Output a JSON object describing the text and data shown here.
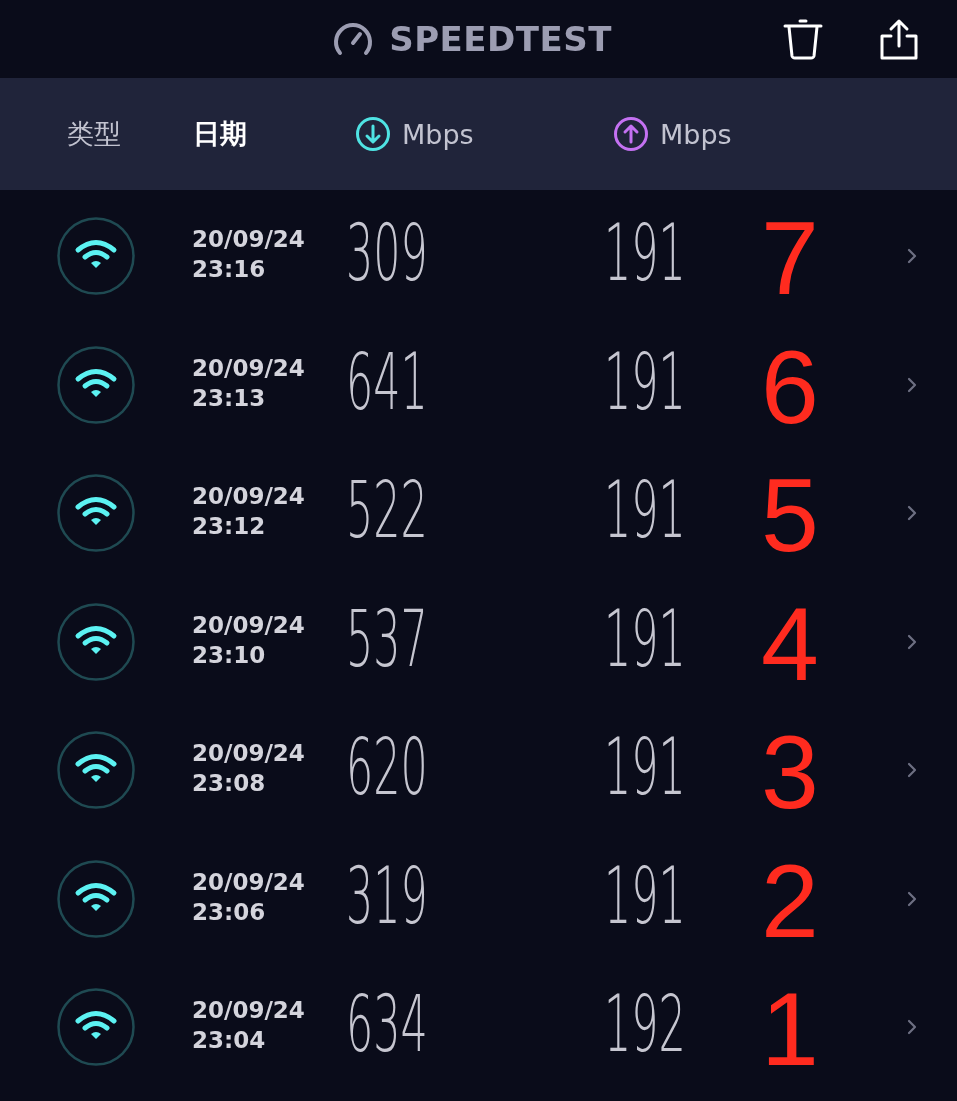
{
  "app_bar": {
    "title": "SPEEDTEST"
  },
  "columns": [
    {
      "kind": "type",
      "label": "类型",
      "selected": false
    },
    {
      "kind": "date",
      "label": "日期",
      "selected": true
    },
    {
      "kind": "download",
      "label": "Mbps",
      "selected": false
    },
    {
      "kind": "upload",
      "label": "Mbps",
      "selected": false
    }
  ],
  "rows": [
    {
      "kind": "wifi",
      "date": "20/09/24",
      "time": "23:16",
      "download": "309",
      "upload": "191",
      "annotation": "7"
    },
    {
      "kind": "wifi",
      "date": "20/09/24",
      "time": "23:13",
      "download": "641",
      "upload": "191",
      "annotation": "6"
    },
    {
      "kind": "wifi",
      "date": "20/09/24",
      "time": "23:12",
      "download": "522",
      "upload": "191",
      "annotation": "5"
    },
    {
      "kind": "wifi",
      "date": "20/09/24",
      "time": "23:10",
      "download": "537",
      "upload": "191",
      "annotation": "4"
    },
    {
      "kind": "wifi",
      "date": "20/09/24",
      "time": "23:08",
      "download": "620",
      "upload": "191",
      "annotation": "3"
    },
    {
      "kind": "wifi",
      "date": "20/09/24",
      "time": "23:06",
      "download": "319",
      "upload": "191",
      "annotation": "2"
    },
    {
      "kind": "wifi",
      "date": "20/09/24",
      "time": "23:04",
      "download": "634",
      "upload": "192",
      "annotation": "1"
    }
  ]
}
